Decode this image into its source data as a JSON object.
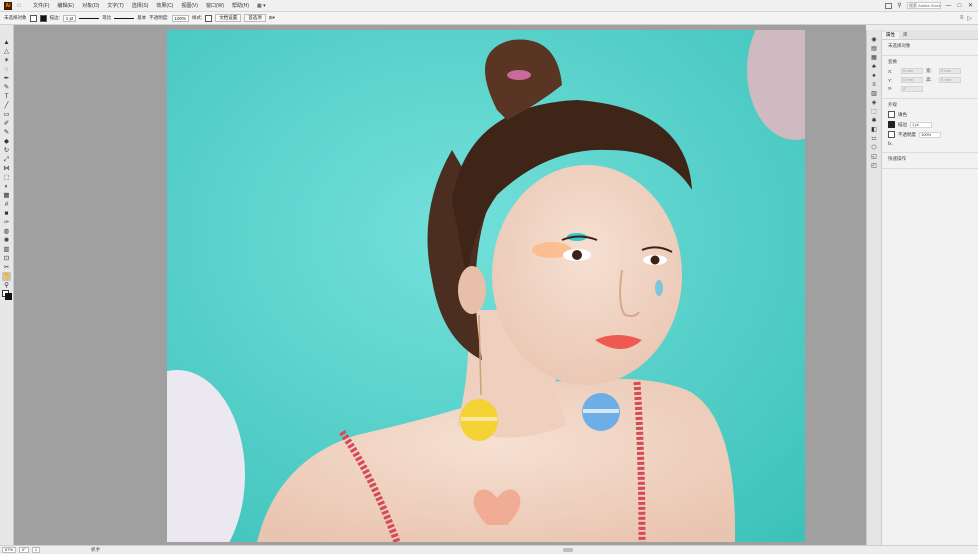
{
  "app": {
    "logo": "Ai"
  },
  "menubar": {
    "items": [
      "文件(F)",
      "编辑(E)",
      "对象(O)",
      "文字(T)",
      "选择(S)",
      "效果(C)",
      "视图(V)",
      "窗口(W)",
      "帮助(H)",
      "▦ ▾"
    ],
    "search_placeholder": "搜索 Adobe Stock",
    "right_icons": [
      "arrange-docs-icon",
      "search-icon"
    ],
    "window_controls": [
      "—",
      "□",
      "✕"
    ]
  },
  "controlbar": {
    "selection_label": "未选择对象",
    "stroke_label": "描边:",
    "stroke_weight": "1 pt",
    "profile_label": "等比",
    "brush_label": "基本",
    "opacity_label": "不透明度:",
    "opacity_value": "100%",
    "style_label": "样式:",
    "doc_setup_btn": "文档设置",
    "prefs_btn": "首选项",
    "right_icons": [
      "≡",
      "▷"
    ]
  },
  "tools": [
    {
      "icon": "selection-tool-icon",
      "glyph": "▲"
    },
    {
      "icon": "direct-selection-tool-icon",
      "glyph": "△"
    },
    {
      "icon": "magic-wand-tool-icon",
      "glyph": "✶"
    },
    {
      "icon": "lasso-tool-icon",
      "glyph": "◌"
    },
    {
      "icon": "pen-tool-icon",
      "glyph": "✒"
    },
    {
      "icon": "curvature-tool-icon",
      "glyph": "✎"
    },
    {
      "icon": "type-tool-icon",
      "glyph": "T"
    },
    {
      "icon": "line-tool-icon",
      "glyph": "╱"
    },
    {
      "icon": "rectangle-tool-icon",
      "glyph": "▭"
    },
    {
      "icon": "paintbrush-tool-icon",
      "glyph": "✐"
    },
    {
      "icon": "shaper-tool-icon",
      "glyph": "✎"
    },
    {
      "icon": "eraser-tool-icon",
      "glyph": "◆"
    },
    {
      "icon": "rotate-tool-icon",
      "glyph": "↻"
    },
    {
      "icon": "scale-tool-icon",
      "glyph": "⤢"
    },
    {
      "icon": "width-tool-icon",
      "glyph": "⋈"
    },
    {
      "icon": "free-transform-tool-icon",
      "glyph": "⬚"
    },
    {
      "icon": "shape-builder-tool-icon",
      "glyph": "◐"
    },
    {
      "icon": "perspective-grid-tool-icon",
      "glyph": "▦"
    },
    {
      "icon": "mesh-tool-icon",
      "glyph": "#"
    },
    {
      "icon": "gradient-tool-icon",
      "glyph": "■"
    },
    {
      "icon": "eyedropper-tool-icon",
      "glyph": "✑"
    },
    {
      "icon": "blend-tool-icon",
      "glyph": "◍"
    },
    {
      "icon": "symbol-sprayer-tool-icon",
      "glyph": "✺"
    },
    {
      "icon": "column-graph-tool-icon",
      "glyph": "▥"
    },
    {
      "icon": "artboard-tool-icon",
      "glyph": "⊡"
    },
    {
      "icon": "slice-tool-icon",
      "glyph": "✂"
    },
    {
      "icon": "hand-tool-icon",
      "glyph": "✋"
    },
    {
      "icon": "zoom-tool-icon",
      "glyph": "⚲"
    }
  ],
  "dock_icons": [
    "◉",
    "▤",
    "▦",
    "♣",
    "♠",
    "≡",
    "▥",
    "◈",
    "⬚",
    "✱",
    "◧",
    "⚏",
    "⬡",
    "◱",
    "◰"
  ],
  "panel": {
    "tabs": [
      "属性",
      "库"
    ],
    "active_tab": "属性",
    "no_selection": "未选择对象",
    "transform_title": "变换",
    "x_label": "X:",
    "y_label": "Y:",
    "w_label": "宽:",
    "h_label": "高:",
    "field_placeholder": "0 mm",
    "angle_placeholder": "0°",
    "appearance_title": "外观",
    "fill_label": "填色",
    "stroke_label": "描边",
    "stroke_value": "1 pt",
    "opacity_label": "不透明度",
    "opacity_value": "100%",
    "fx_label": "fx.",
    "quick_actions_title": "快速操作"
  },
  "statusbar": {
    "zoom": "67%",
    "angle": "0°",
    "artboard_number": "1",
    "tool_name": "抓手"
  }
}
